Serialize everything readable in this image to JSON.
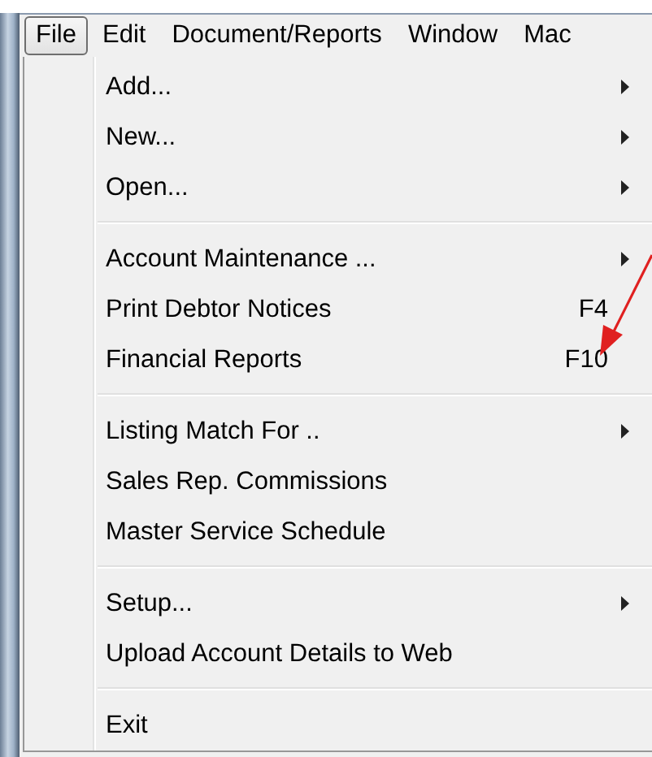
{
  "menubar": [
    {
      "label": "File",
      "selected": true
    },
    {
      "label": "Edit",
      "selected": false
    },
    {
      "label": "Document/Reports",
      "selected": false
    },
    {
      "label": "Window",
      "selected": false
    },
    {
      "label": "Mac",
      "selected": false
    }
  ],
  "menu": {
    "groups": [
      {
        "items": [
          {
            "label": "Add...",
            "has_submenu": true
          },
          {
            "label": "New...",
            "has_submenu": true
          },
          {
            "label": "Open...",
            "has_submenu": true
          }
        ]
      },
      {
        "items": [
          {
            "label": "Account Maintenance ...",
            "has_submenu": true
          },
          {
            "label": "Print Debtor Notices",
            "shortcut": "F4",
            "has_submenu": false
          },
          {
            "label": "Financial Reports",
            "shortcut": "F10",
            "has_submenu": false
          }
        ]
      },
      {
        "items": [
          {
            "label": "Listing Match For ..",
            "has_submenu": true
          },
          {
            "label": "Sales Rep. Commissions",
            "has_submenu": false
          },
          {
            "label": "Master Service Schedule",
            "has_submenu": false
          }
        ]
      },
      {
        "items": [
          {
            "label": "Setup...",
            "has_submenu": true
          },
          {
            "label": "Upload Account Details to Web",
            "has_submenu": false
          }
        ]
      },
      {
        "items": [
          {
            "label": "Exit",
            "has_submenu": false
          }
        ]
      }
    ]
  }
}
